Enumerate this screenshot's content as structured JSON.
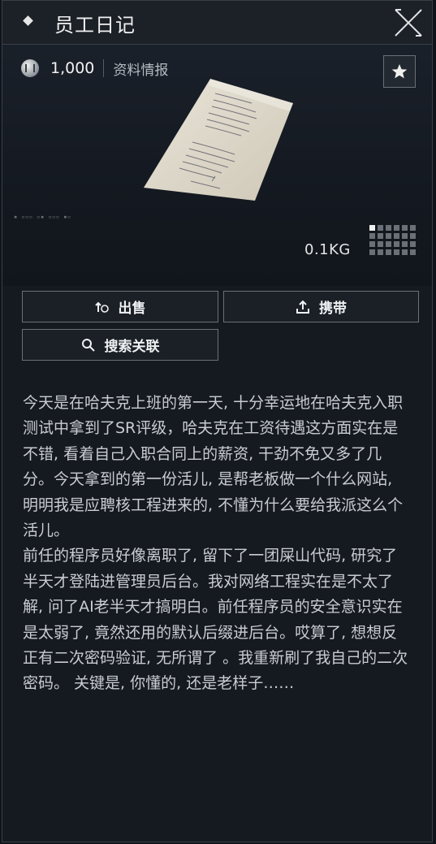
{
  "header": {
    "title": "员工日记"
  },
  "item": {
    "price": "1,000",
    "category": "资料情报",
    "weight": "0.1KG"
  },
  "actions": {
    "sell_label": "出售",
    "carry_label": "携带",
    "search_label": "搜索关联"
  },
  "description": {
    "paragraph_1": "今天是在哈夫克上班的第一天, 十分幸运地在哈夫克入职测试中拿到了SR评级，哈夫克在工资待遇这方面实在是不错, 看着自己入职合同上的薪资, 干劲不免又多了几分。今天拿到的第一份活儿, 是帮老板做一个什么网站, 明明我是应聘核工程进来的, 不懂为什么要给我派这么个活儿。",
    "paragraph_2": "前任的程序员好像离职了, 留下了一团屎山代码, 研究了半天才登陆进管理员后台。我对网络工程实在是不太了解, 问了AI老半天才搞明白。前任程序员的安全意识实在是太弱了, 竟然还用的默认后缀进后台。哎算了, 想想反正有二次密码验证, 无所谓了 。我重新刷了我自己的二次密码。 关键是, 你懂的, 还是老样子……"
  },
  "icons": {
    "header": "diamond-icon",
    "close": "close-x-icon",
    "coin": "coin-icon",
    "favorite": "star-icon",
    "sell": "sell-icon",
    "carry": "upload-icon",
    "search": "search-icon",
    "size": "grid-size-icon"
  },
  "colors": {
    "background": "#151a21",
    "text": "#c9ccd0",
    "border": "#69707a"
  }
}
